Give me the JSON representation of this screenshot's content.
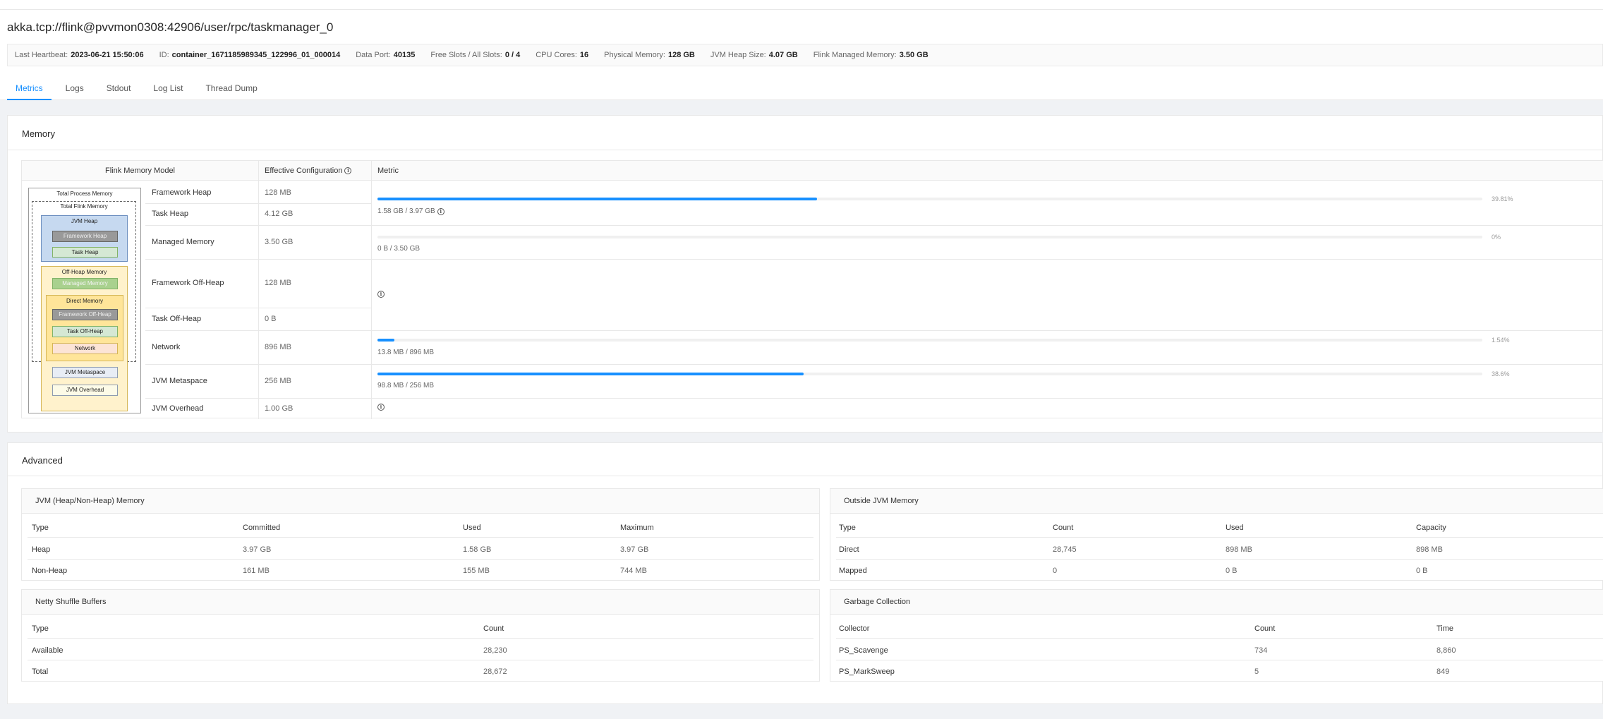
{
  "page_title": "akka.tcp://flink@pvvmon0308:42906/user/rpc/taskmanager_0",
  "info_bar": [
    {
      "key": "Last Heartbeat:",
      "value": "2023-06-21 15:50:06"
    },
    {
      "key": "ID:",
      "value": "container_1671185989345_122996_01_000014"
    },
    {
      "key": "Data Port:",
      "value": "40135"
    },
    {
      "key": "Free Slots / All Slots:",
      "value": "0 / 4"
    },
    {
      "key": "CPU Cores:",
      "value": "16"
    },
    {
      "key": "Physical Memory:",
      "value": "128 GB"
    },
    {
      "key": "JVM Heap Size:",
      "value": "4.07 GB"
    },
    {
      "key": "Flink Managed Memory:",
      "value": "3.50 GB"
    }
  ],
  "tabs": [
    "Metrics",
    "Logs",
    "Stdout",
    "Log List",
    "Thread Dump"
  ],
  "memory": {
    "title": "Memory",
    "headers": {
      "model": "Flink Memory Model",
      "config": "Effective Configuration",
      "metric": "Metric"
    },
    "rows": [
      {
        "label": "Framework Heap",
        "config": "128 MB"
      },
      {
        "label": "Task Heap",
        "config": "4.12 GB"
      },
      {
        "label": "Managed Memory",
        "config": "3.50 GB"
      },
      {
        "label": "Framework Off-Heap",
        "config": "128 MB"
      },
      {
        "label": "Task Off-Heap",
        "config": "0 B"
      },
      {
        "label": "Network",
        "config": "896 MB"
      },
      {
        "label": "JVM Metaspace",
        "config": "256 MB"
      },
      {
        "label": "JVM Overhead",
        "config": "1.00 GB"
      }
    ],
    "metrics": [
      {
        "fraction": 0.3981,
        "pct": "39.81%",
        "text": "1.58 GB / 3.97 GB"
      },
      {
        "fraction": 0.0,
        "pct": "0%",
        "text": "0 B / 3.50 GB"
      },
      {
        "fraction": 0.0154,
        "pct": "1.54%",
        "text": "13.8 MB / 896 MB"
      },
      {
        "fraction": 0.386,
        "pct": "38.6%",
        "text": "98.8 MB / 256 MB"
      }
    ],
    "diagram": {
      "total_process": "Total Process Memory",
      "total_flink": "Total Flink Memory",
      "jvm_heap": "JVM Heap",
      "framework_heap": "Framework Heap",
      "task_heap": "Task Heap",
      "off_heap": "Off-Heap Memory",
      "managed": "Managed Memory",
      "direct": "Direct Memory",
      "framework_off_heap": "Framework Off-Heap",
      "task_off_heap": "Task Off-Heap",
      "network": "Network",
      "jvm_metaspace": "JVM Metaspace",
      "jvm_overhead": "JVM Overhead"
    }
  },
  "advanced": {
    "title": "Advanced",
    "jvm": {
      "title": "JVM (Heap/Non-Heap) Memory",
      "headers": [
        "Type",
        "Committed",
        "Used",
        "Maximum"
      ],
      "rows": [
        [
          "Heap",
          "3.97 GB",
          "1.58 GB",
          "3.97 GB"
        ],
        [
          "Non-Heap",
          "161 MB",
          "155 MB",
          "744 MB"
        ]
      ]
    },
    "outside": {
      "title": "Outside JVM Memory",
      "headers": [
        "Type",
        "Count",
        "Used",
        "Capacity"
      ],
      "rows": [
        [
          "Direct",
          "28,745",
          "898 MB",
          "898 MB"
        ],
        [
          "Mapped",
          "0",
          "0 B",
          "0 B"
        ]
      ]
    },
    "netty": {
      "title": "Netty Shuffle Buffers",
      "headers": [
        "Type",
        "Count"
      ],
      "rows": [
        [
          "Available",
          "28,230"
        ],
        [
          "Total",
          "28,672"
        ]
      ]
    },
    "gc": {
      "title": "Garbage Collection",
      "headers": [
        "Collector",
        "Count",
        "Time"
      ],
      "rows": [
        [
          "PS_Scavenge",
          "734",
          "8,860"
        ],
        [
          "PS_MarkSweep",
          "5",
          "849"
        ]
      ]
    }
  },
  "colors": {
    "accent": "#1890ff"
  }
}
